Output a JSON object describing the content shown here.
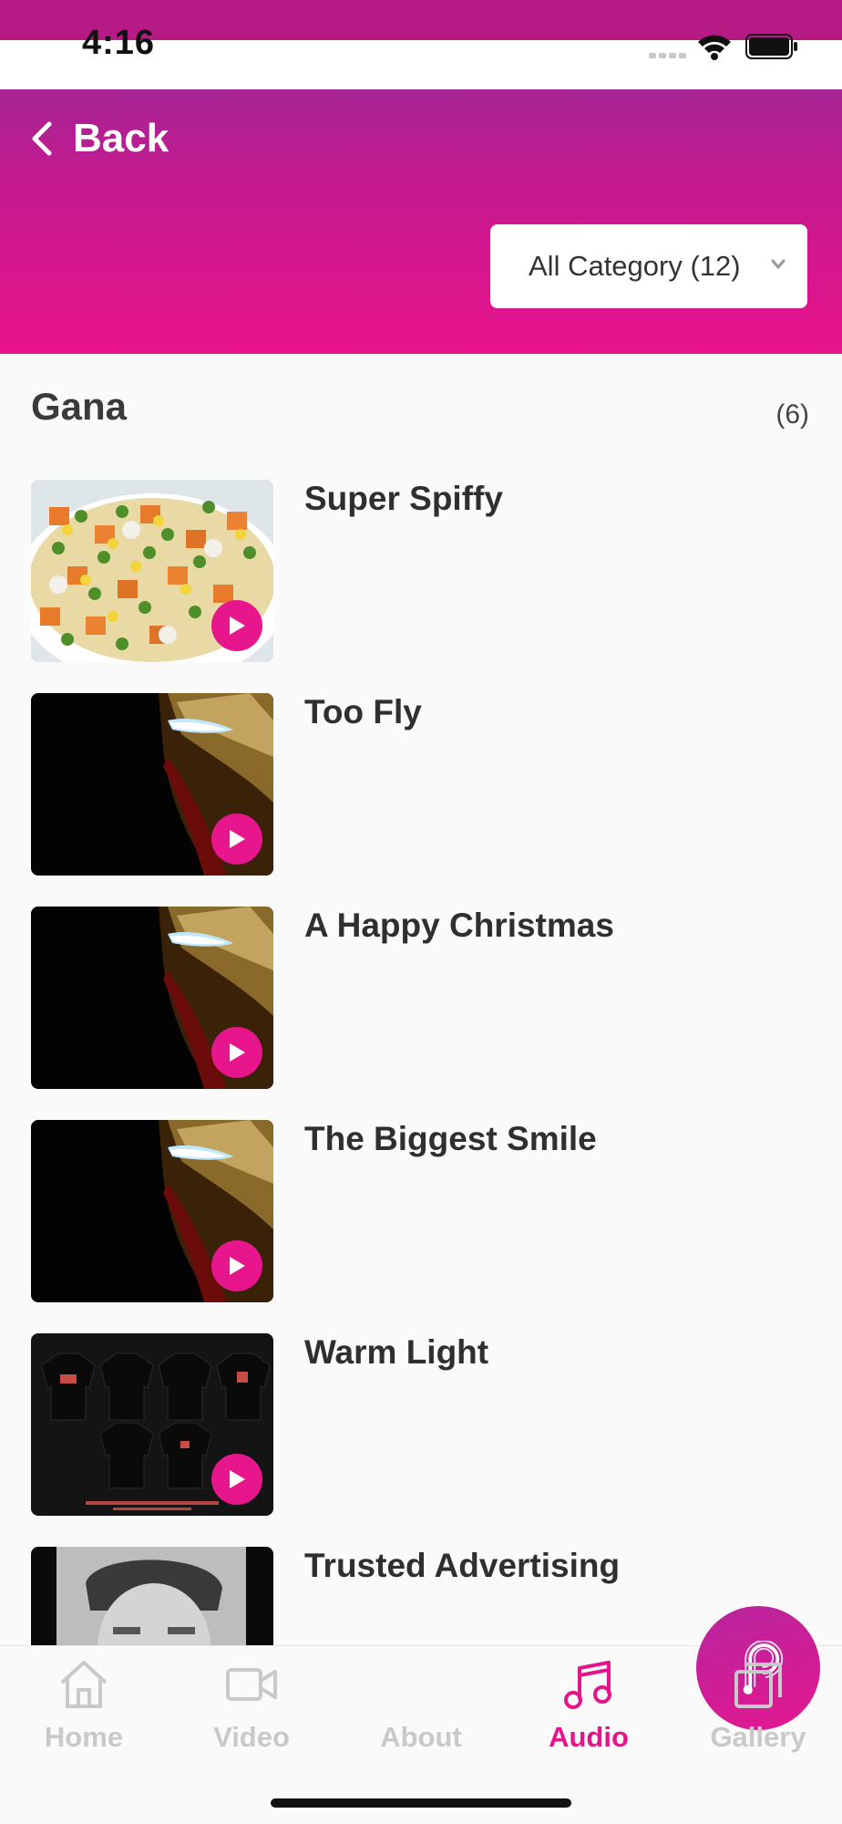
{
  "status_bar": {
    "time": "4:16"
  },
  "header": {
    "back_label": "Back",
    "category_selected": "All Category (12)"
  },
  "section": {
    "title": "Gana",
    "count": "(6)"
  },
  "items": [
    {
      "title": "Super Spiffy"
    },
    {
      "title": "Too Fly"
    },
    {
      "title": "A Happy Christmas"
    },
    {
      "title": "The Biggest Smile"
    },
    {
      "title": "Warm Light"
    },
    {
      "title": "Trusted Advertising"
    }
  ],
  "tabs": [
    {
      "label": "Home",
      "icon": "home-icon"
    },
    {
      "label": "Video",
      "icon": "video-icon"
    },
    {
      "label": "About",
      "icon": "about-logo-icon"
    },
    {
      "label": "Audio",
      "icon": "music-note-icon",
      "active": true
    },
    {
      "label": "Gallery",
      "icon": "gallery-icon"
    }
  ],
  "colors": {
    "accent": "#e7168c",
    "header_top": "#a52493",
    "header_bottom": "#e8138c",
    "tab_inactive": "#c9c9c9"
  }
}
